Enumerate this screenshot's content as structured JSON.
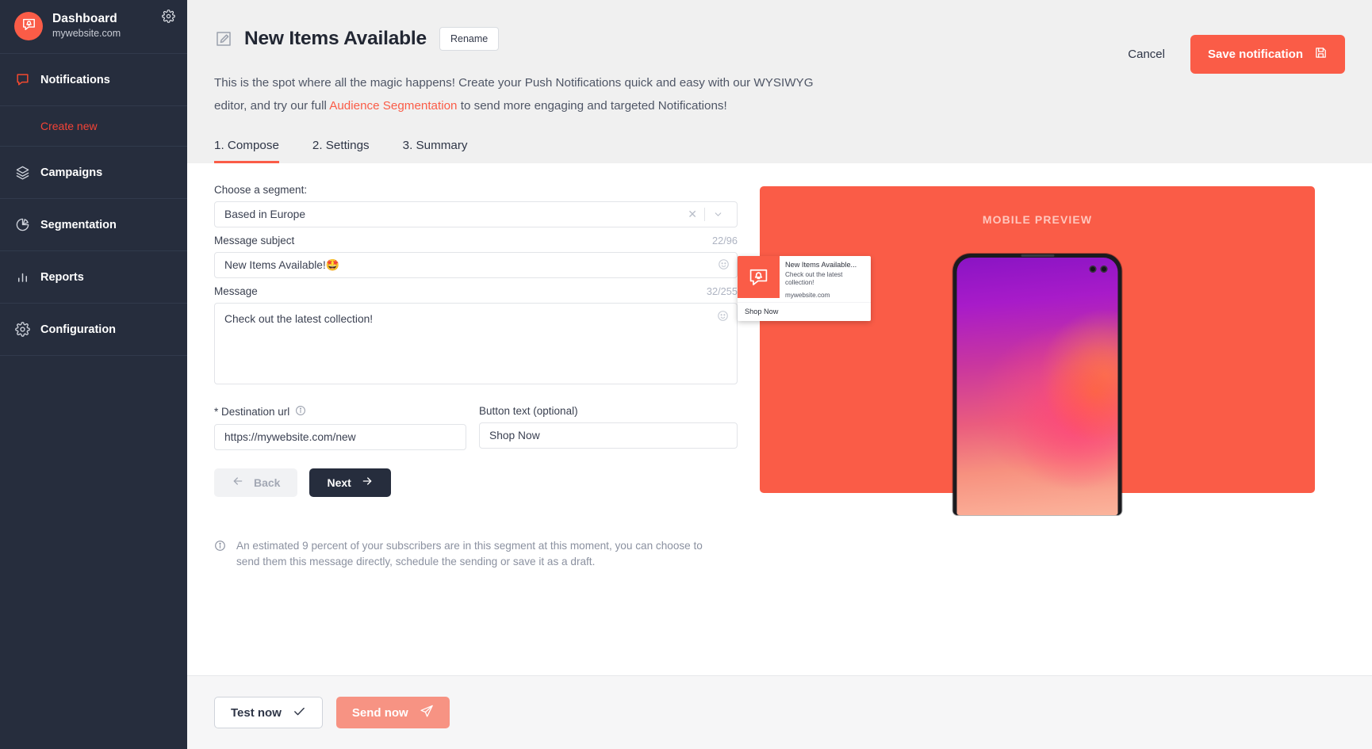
{
  "sidebar": {
    "brand": {
      "title": "Dashboard",
      "subtitle": "mywebsite.com",
      "logo_icon": "bell-chat-icon",
      "gear_icon": "gear-icon"
    },
    "items": [
      {
        "label": "Notifications",
        "icon": "chat-bubble-icon",
        "active": true
      },
      {
        "label": "Create new",
        "icon": "",
        "sub": true
      },
      {
        "label": "Campaigns",
        "icon": "layers-icon"
      },
      {
        "label": "Segmentation",
        "icon": "pie-chart-icon"
      },
      {
        "label": "Reports",
        "icon": "bar-chart-icon"
      },
      {
        "label": "Configuration",
        "icon": "gear-icon"
      }
    ]
  },
  "header": {
    "edit_icon": "pencil-square-icon",
    "title": "New Items Available",
    "rename_label": "Rename",
    "cancel_label": "Cancel",
    "save_label": "Save notification",
    "save_icon": "floppy-disk-icon",
    "description_part1": "This is the spot where all the magic happens! Create your Push Notifications quick and easy with our WYSIWYG editor, and try our full ",
    "description_link": "Audience Segmentation",
    "description_part2": " to send more engaging and targeted Notifications!"
  },
  "tabs": [
    {
      "label": "1. Compose",
      "active": true
    },
    {
      "label": "2. Settings",
      "active": false
    },
    {
      "label": "3. Summary",
      "active": false
    }
  ],
  "form": {
    "segment_label": "Choose a segment:",
    "segment_value": "Based in Europe",
    "segment_clear_icon": "close-icon",
    "segment_chevron_icon": "chevron-down-icon",
    "subject_label": "Message subject",
    "subject_counter": "22/96",
    "subject_value": "New Items Available!",
    "subject_emoji": "🤩",
    "subject_emoji_picker_icon": "emoji-icon",
    "message_label": "Message",
    "message_counter": "32/255",
    "message_value": "Check out the latest collection!",
    "message_emoji_picker_icon": "emoji-icon",
    "url_label": "* Destination url",
    "url_info_icon": "info-icon",
    "url_value": "https://mywebsite.com/new",
    "button_text_label": "Button text (optional)",
    "button_text_value": "Shop Now",
    "back_label": "Back",
    "back_icon": "arrow-left-icon",
    "next_label": "Next",
    "next_icon": "arrow-right-icon",
    "estimate_icon": "info-icon",
    "estimate_note": "An estimated 9 percent of your subscribers are in this segment at this moment, you can choose to send them this message directly, schedule the sending or save it as a draft."
  },
  "preview": {
    "panel_title": "MOBILE PREVIEW",
    "notification": {
      "icon": "bell-chat-icon",
      "title": "New Items Available...",
      "body": "Check out the latest collection!",
      "host": "mywebsite.com",
      "action_label": "Shop Now"
    }
  },
  "footer": {
    "test_label": "Test now",
    "test_icon": "check-icon",
    "send_label": "Send now",
    "send_icon": "paper-plane-icon"
  },
  "colors": {
    "accent": "#fa5c47",
    "sidebar_bg": "#262d3d",
    "header_bg": "#f0f0f0",
    "dark_button": "#262d3d",
    "send_disabled": "#f79383"
  }
}
